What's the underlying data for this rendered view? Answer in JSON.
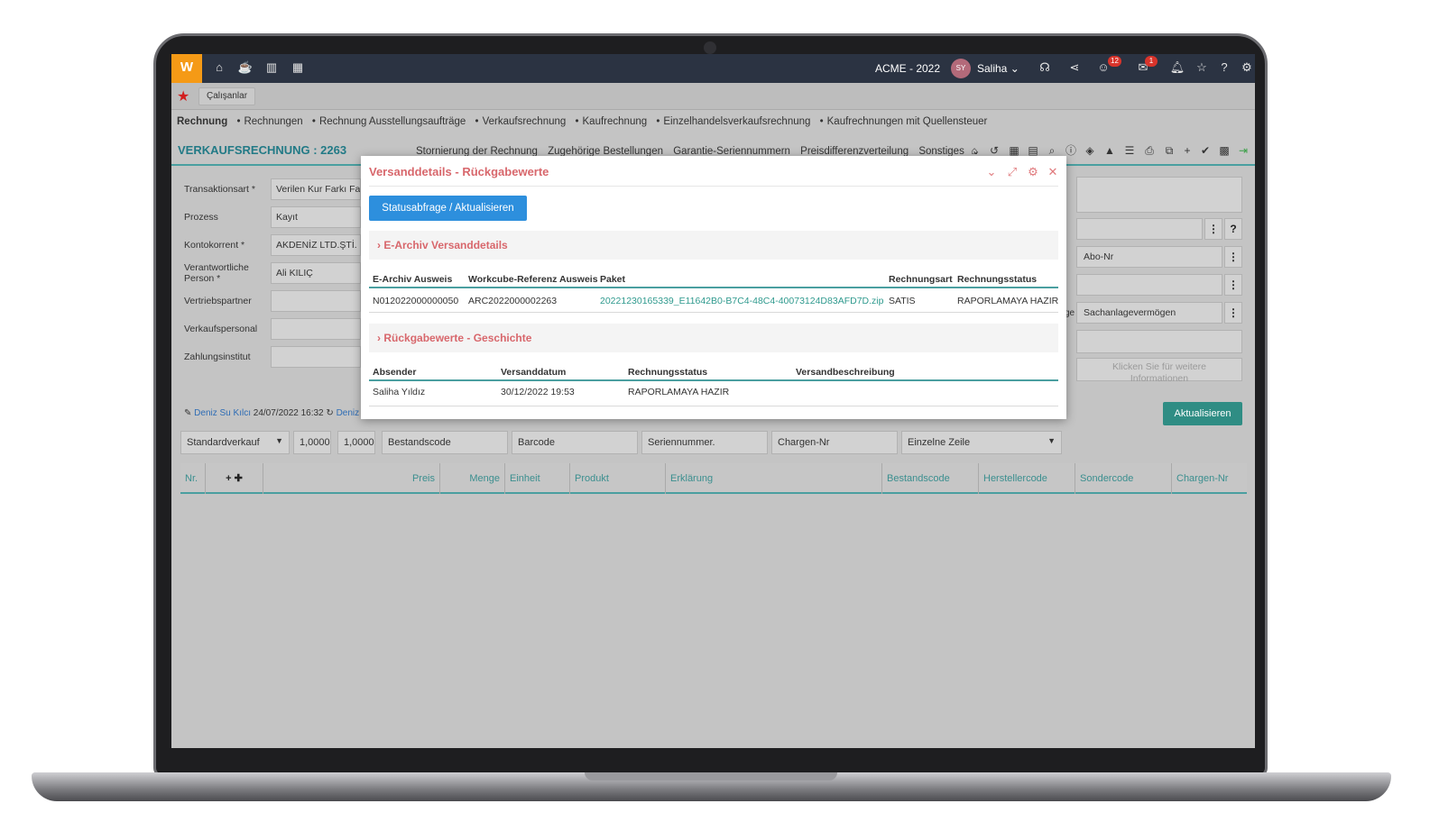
{
  "topbar": {
    "logo": "W",
    "company": "ACME - 2022",
    "avatar_initials": "SY",
    "user_name": "Saliha",
    "notifications_count": "12",
    "messages_count": "1"
  },
  "tabs": {
    "active_tab": "Çalışanlar"
  },
  "breadcrumb": [
    "Rechnung",
    "Rechnungen",
    "Rechnung Ausstellungsaufträge",
    "Verkaufsrechnung",
    "Kaufrechnung",
    "Einzelhandelsverkaufsrechnung",
    "Kaufrechnungen mit Quellensteuer"
  ],
  "page": {
    "title": "VERKAUFSRECHNUNG : 2263",
    "actions": [
      "Stornierung der Rechnung",
      "Zugehörige Bestellungen",
      "Garantie-Seriennummern",
      "Preisdifferenzverteilung",
      "Sonstiges"
    ]
  },
  "form": {
    "transaktionsart_label": "Transaktionsart *",
    "transaktionsart_value": "Verilen Kur Farkı Fat",
    "prozess_label": "Prozess",
    "prozess_value": "Kayıt",
    "kontokorrent_label": "Kontokorrent *",
    "kontokorrent_value": "AKDENİZ LTD.ŞTİ.",
    "person_label_1": "Verantwortliche",
    "person_label_2": "Person *",
    "person_value": "Ali KILIÇ",
    "vertriebspartner_label": "Vertriebspartner",
    "verkaufspersonal_label": "Verkaufspersonal",
    "zahlungsinstitut_label": "Zahlungsinstitut"
  },
  "right_panel": {
    "question_mark": "?",
    "abo_nr": "Abo-Nr",
    "partial_label": "ge",
    "sachanlage": "Sachanlagevermögen",
    "more_info": "Klicken Sie für weitere Informationen"
  },
  "record": {
    "editor": "Deniz Su Kılcı",
    "edit_date": "24/07/2022 16:32",
    "second_editor": "Deniz",
    "update_button": "Aktualisieren"
  },
  "input_row": {
    "type": "Standardverkauf",
    "rate1": "1,0000",
    "rate2": "1,0000",
    "bestandscode": "Bestandscode",
    "barcode": "Barcode",
    "seriennummer": "Seriennummer.",
    "chargen": "Chargen-Nr",
    "mode": "Einzelne Zeile"
  },
  "grid": {
    "columns": [
      "Nr.",
      "Preis",
      "Menge",
      "Einheit",
      "Produkt",
      "Erklärung",
      "Bestandscode",
      "Herstellercode",
      "Sondercode",
      "Chargen-Nr"
    ]
  },
  "modal": {
    "title": "Versanddetails - Rückgabewerte",
    "status_button": "Statusabfrage / Aktualisieren",
    "section1": "E-Archiv Versanddetails",
    "table1_headers": [
      "E-Archiv Ausweis",
      "Workcube-Referenz Ausweis",
      "Paket",
      "Rechnungsart",
      "Rechnungsstatus"
    ],
    "table1_row": [
      "N012022000000050",
      "ARC2022000002263",
      "20221230165339_E11642B0-B7C4-48C4-40073124D83AFD7D.zip",
      "SATIS",
      "RAPORLAMAYA HAZIR"
    ],
    "section2": "Rückgabewerte - Geschichte",
    "table2_headers": [
      "Absender",
      "Versanddatum",
      "Rechnungsstatus",
      "Versandbeschreibung"
    ],
    "table2_row": [
      "Saliha Yıldız",
      "30/12/2022 19:53",
      "RAPORLAMAYA HAZIR",
      ""
    ]
  }
}
